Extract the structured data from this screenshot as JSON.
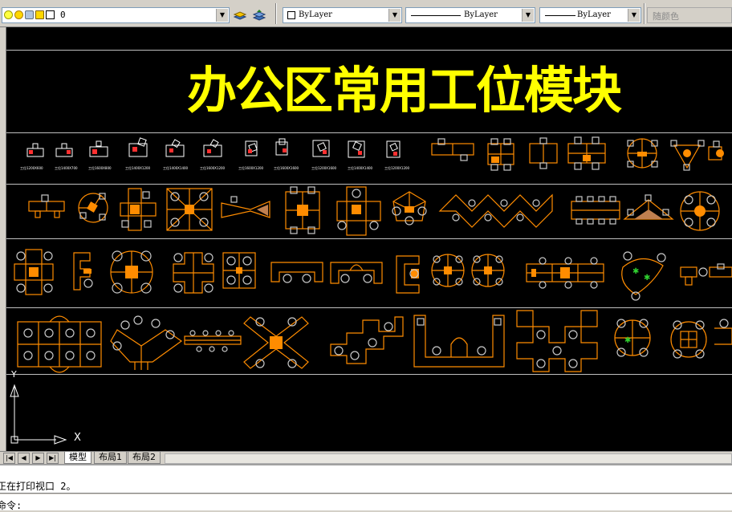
{
  "toolbar": {
    "layer_name": "0",
    "color_value": "ByLayer",
    "linetype_value": "ByLayer",
    "lineweight_value": "ByLayer",
    "plotstyle_value": "随颜色"
  },
  "drawing": {
    "title": "办公区常用工位模块",
    "ucs_x_label": "X",
    "ucs_y_label": "Y",
    "colors": {
      "background": "#000000",
      "title": "#ffff00",
      "blocks": "#ff8c00",
      "lines": "#c0c0c0",
      "chairs": "#c8c8c8"
    }
  },
  "tabs": [
    {
      "label": "模型",
      "active": true
    },
    {
      "label": "布局1",
      "active": false
    },
    {
      "label": "布局2",
      "active": false
    }
  ],
  "command": {
    "history_line": "正在打印视口 2。",
    "prompt": "命令:"
  }
}
